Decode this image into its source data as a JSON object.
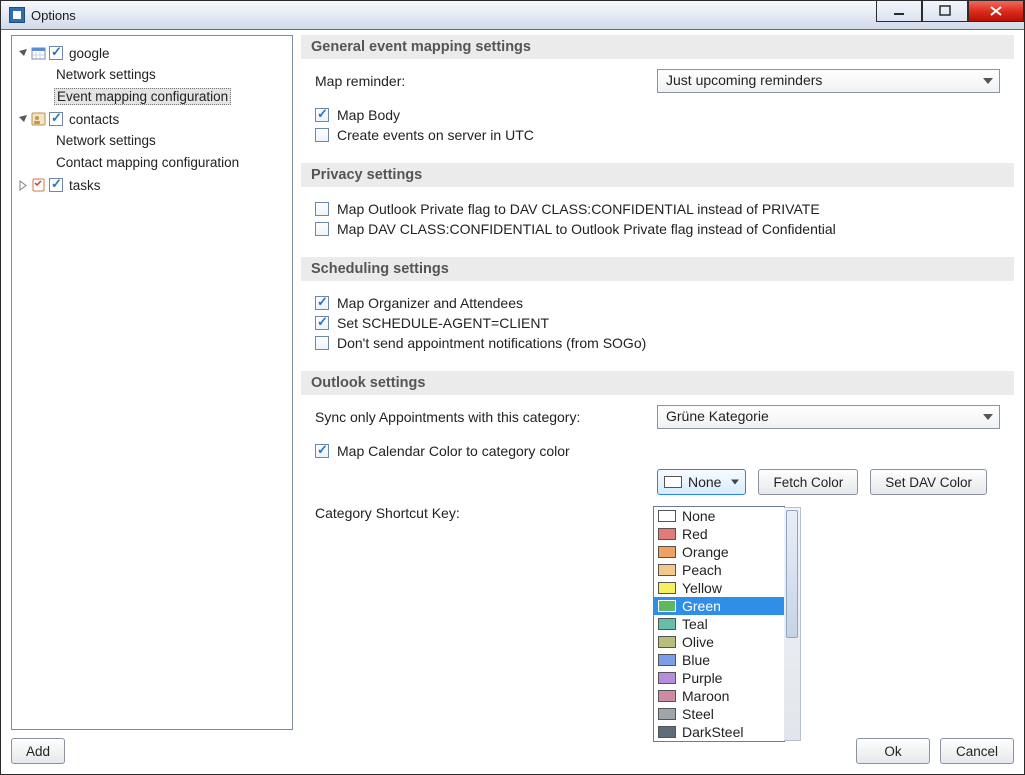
{
  "window": {
    "title": "Options"
  },
  "tree": {
    "google": {
      "label": "google",
      "children": {
        "net": "Network settings",
        "evmap": "Event mapping configuration"
      }
    },
    "contacts": {
      "label": "contacts",
      "children": {
        "net": "Network settings",
        "cmap": "Contact mapping configuration"
      }
    },
    "tasks": {
      "label": "tasks"
    }
  },
  "buttons": {
    "add": "Add",
    "ok": "Ok",
    "cancel": "Cancel",
    "fetch_color": "Fetch Color",
    "set_dav_color": "Set DAV Color"
  },
  "sections": {
    "general": "General event mapping settings",
    "privacy": "Privacy settings",
    "scheduling": "Scheduling settings",
    "outlook": "Outlook settings"
  },
  "general": {
    "map_reminder_label": "Map reminder:",
    "map_reminder_value": "Just upcoming reminders",
    "map_body": "Map Body",
    "create_utc": "Create events on server in UTC"
  },
  "privacy": {
    "map_private": "Map Outlook Private flag to DAV CLASS:CONFIDENTIAL instead of PRIVATE",
    "map_confidential": "Map DAV CLASS:CONFIDENTIAL to Outlook Private flag instead of Confidential"
  },
  "scheduling": {
    "map_org": "Map Organizer and Attendees",
    "set_agent": "Set SCHEDULE-AGENT=CLIENT",
    "no_sogo": "Don't send appointment notifications (from SOGo)"
  },
  "outlook": {
    "sync_cat_label": "Sync only Appointments with this category:",
    "sync_cat_value": "Grüne Kategorie",
    "map_color": "Map Calendar Color to category color",
    "none_label": "None",
    "shortcut_label": "Category Shortcut Key:"
  },
  "color_options": [
    {
      "name": "None",
      "hex": "#ffffff"
    },
    {
      "name": "Red",
      "hex": "#e27a7a"
    },
    {
      "name": "Orange",
      "hex": "#f0a060"
    },
    {
      "name": "Peach",
      "hex": "#f3c889"
    },
    {
      "name": "Yellow",
      "hex": "#f6ef5e"
    },
    {
      "name": "Green",
      "hex": "#5fb75f",
      "selected": true
    },
    {
      "name": "Teal",
      "hex": "#66c0a8"
    },
    {
      "name": "Olive",
      "hex": "#b9bf7a"
    },
    {
      "name": "Blue",
      "hex": "#7c9de8"
    },
    {
      "name": "Purple",
      "hex": "#b88dd8"
    },
    {
      "name": "Maroon",
      "hex": "#cf8aa6"
    },
    {
      "name": "Steel",
      "hex": "#9da6ad"
    },
    {
      "name": "DarkSteel",
      "hex": "#5e6b78"
    }
  ]
}
